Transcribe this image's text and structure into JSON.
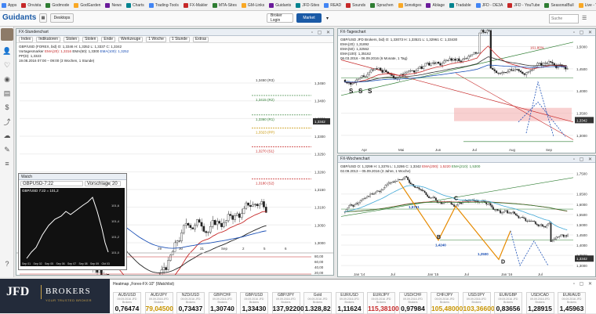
{
  "bookmarks": [
    "Apps",
    "Onvista",
    "Godmode",
    "GodGarden",
    "News",
    "Charts",
    "Trading-Tools",
    "FX-Makler",
    "MTA-Sites",
    "GM-Links",
    "Guidants",
    "JFD-Sites",
    "READ",
    "Sounds",
    "Sprachen",
    "Sonstiges",
    "Ablage",
    "Tradable",
    "JFD - DE3A",
    "JFD - YouTube",
    "SeasonalBull",
    "Live - YouTube"
  ],
  "toolbar": {
    "logo": "Guidants",
    "desktops_label": "Desktops",
    "broker_login": "Broker Login",
    "market": "Market",
    "search_placeholder": "Suche"
  },
  "chart1": {
    "title": "FX-Stundenchart",
    "tools": [
      "Index",
      "Indikatoren",
      "Stolen",
      "Stolen",
      "Ende",
      "Werkzeuge",
      "1 Woche",
      "1 Stunde",
      "Extras"
    ],
    "line1": "GBP/USD (FOREX, bid) O: 1,3346  H: 1,3352  L: 1,3337  C: 1,3342",
    "line2_prefix": "Vortagesmarker",
    "ema20": "EMA(20): 1,3316",
    "ema50": "EMA(50): 1,3300",
    "ema100": "EMA(100): 1,3252",
    "line3": "PP(D): 1,3323",
    "line4": "19.08.2016 07:00 – 09:00 (3 Wochen, 1 Stunde)",
    "levels": [
      "1,3415 (R2)",
      "1,3360 (R1)",
      "1,3323 (PP)",
      "1,3270 (S1)",
      "1,3180 (S2)"
    ],
    "yticks": [
      "1,3450",
      "1,3400",
      "1,3350",
      "1,3300",
      "1,3250",
      "1,3200",
      "1,3150",
      "1,3100",
      "1,3050",
      "1,3000"
    ],
    "price_tag": "1,3342",
    "top_tag": "1,3450 (R3)",
    "xticks": [
      "29",
      "30",
      "31",
      "Sep",
      "2",
      "5",
      "6"
    ],
    "osc_ticks": [
      "80,00",
      "60,00",
      "40,00",
      "20,00"
    ]
  },
  "mini_chart": {
    "title": "Watch",
    "symbol": "GBPUSD-7:22",
    "mode": "Vorschlage",
    "count": "20",
    "header": "GBP/USD 7:22 = 101,2",
    "yticks": [
      "101,6",
      "101,4",
      "101,2",
      "101,0"
    ],
    "xticks": [
      "Sep 01",
      "Sep 02",
      "Sep 05",
      "Sep 06",
      "Sep 07",
      "Sep 08",
      "Sep 09",
      "Okt 03"
    ]
  },
  "chart2": {
    "title": "FX-Tageschart",
    "line1": "GBP/USD JFD Brokers, bid) O: 1,33073  H: 1,33521  L: 1,32961  C: 1,33430",
    "ema20": "EMA(20): 1,31892",
    "ema50": "EMA(50): 1,32562",
    "ema100": "EMA(100): 1,35162",
    "line4": "06.03.2016 - 06.09.2016 (6 Monate, 1 Tag)",
    "yticks": [
      "1,5000",
      "1,4500",
      "1,4000",
      "1,3500",
      "1,3000"
    ],
    "price_tag": "1,3342",
    "xticks": [
      "Apr",
      "Mai",
      "Jun",
      "Jul",
      "Aug",
      "Sep"
    ],
    "fib": "161,80%",
    "pattern_labels": [
      "S",
      "S",
      "S"
    ]
  },
  "chart3": {
    "title": "FX-Wochenchart",
    "line1": "GBP/USD O: 1,3299  H: 1,3376  L: 1,3286  C: 1,3342",
    "ema200": "EMA(200): 1,5220",
    "ema210": "EMA(210): 1,5300",
    "line3": "02.09.2013 – 05.09.2016 (3 Jahre, 1 Woche)",
    "yticks": [
      "1,7500",
      "1,6500",
      "1,6000",
      "1,5500",
      "1,5000",
      "1,4500",
      "1,4000",
      "1,3500",
      "1,3000"
    ],
    "price_tag": "1,3342",
    "xticks": [
      "Jan '14",
      "Jul",
      "Jan '15",
      "Jul",
      "Jan '16",
      "Jul"
    ],
    "labels": [
      "C",
      "B",
      "D",
      "1,4240",
      "1,2500",
      "1,5761"
    ]
  },
  "watchlist": {
    "title": "Heatmap „Forex-FX-10\" (Watchlist)",
    "items": [
      {
        "sym": "AUD/USD",
        "sub": "09.09.2016 JFD Brokers",
        "val": "0,76474",
        "color": "#111"
      },
      {
        "sym": "AUD/JPY",
        "sub": "09.09.2016 JFD Brokers",
        "val": "79,04500",
        "color": "#c79400"
      },
      {
        "sym": "NZD/USD",
        "sub": "09.09.2016 JFD Brokers",
        "val": "0,73437",
        "color": "#111"
      },
      {
        "sym": "GBP/CHF",
        "sub": "09.09.2016 JFD Brokers",
        "val": "1,30740",
        "color": "#111"
      },
      {
        "sym": "GBP/USD",
        "sub": "09.09.2016 JFD Brokers",
        "val": "1,33430",
        "color": "#111"
      },
      {
        "sym": "GBP/JPY",
        "sub": "09.09.2016 JFD Brokers",
        "val": "137,92200",
        "color": "#111"
      },
      {
        "sym": "Gold",
        "sub": "09.09.2016 JFD Brokers",
        "val": "1.328,82",
        "color": "#111"
      },
      {
        "sym": "EUR/USD",
        "sub": "09.09.2016 JFD Brokers",
        "val": "1,11624",
        "color": "#111"
      },
      {
        "sym": "EUR/JPY",
        "sub": "09.09.2016 JFD Brokers",
        "val": "115,38100",
        "color": "#c62828"
      },
      {
        "sym": "USD/CHF",
        "sub": "09.09.2016 JFD Brokers",
        "val": "0,97984",
        "color": "#111"
      },
      {
        "sym": "CHF/JPY",
        "sub": "09.09.2016 JFD Brokers",
        "val": "105,48000",
        "color": "#c79400"
      },
      {
        "sym": "USD/JPY",
        "sub": "09.09.2016 JFD Brokers",
        "val": "103,36600",
        "color": "#c79400"
      },
      {
        "sym": "EUR/GBP",
        "sub": "09.09.2016 JFD Brokers",
        "val": "0,83656",
        "color": "#111"
      },
      {
        "sym": "USD/CAD",
        "sub": "09.09.2016 JFD Brokers",
        "val": "1,28915",
        "color": "#111"
      },
      {
        "sym": "EUR/AUD",
        "sub": "09.09.2016 JFD Brokers",
        "val": "1,45963",
        "color": "#111"
      }
    ]
  },
  "jfd": {
    "brand": "JFD",
    "brand2": "BROKERS",
    "tagline": "YOUR TRUSTED BROKER"
  }
}
